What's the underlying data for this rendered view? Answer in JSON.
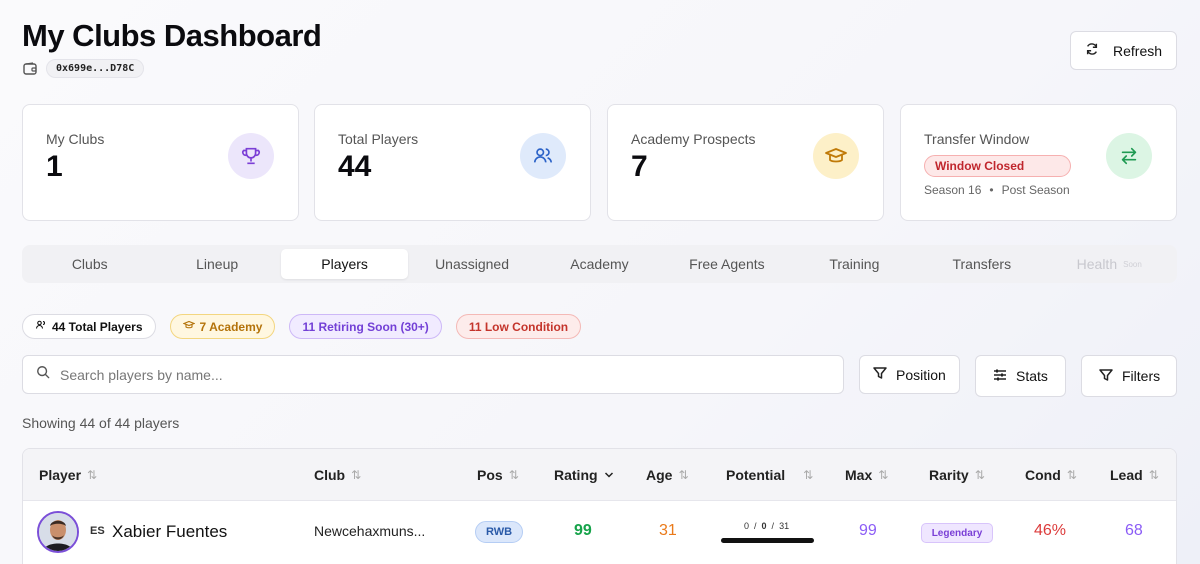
{
  "header": {
    "title": "My Clubs Dashboard",
    "wallet_address": "0x699e...D78C",
    "refresh_label": "Refresh"
  },
  "stats": {
    "clubs": {
      "label": "My Clubs",
      "value": "1",
      "icon": "trophy-icon"
    },
    "players": {
      "label": "Total Players",
      "value": "44",
      "icon": "users-icon"
    },
    "academy": {
      "label": "Academy Prospects",
      "value": "7",
      "icon": "graduation-cap-icon"
    },
    "transfer": {
      "label": "Transfer Window",
      "status": "Window Closed",
      "season": "Season 16",
      "phase": "Post Season",
      "icon": "swap-arrows-icon"
    }
  },
  "tabs": [
    {
      "label": "Clubs"
    },
    {
      "label": "Lineup"
    },
    {
      "label": "Players"
    },
    {
      "label": "Unassigned"
    },
    {
      "label": "Academy"
    },
    {
      "label": "Free Agents"
    },
    {
      "label": "Training"
    },
    {
      "label": "Transfers"
    },
    {
      "label": "Health",
      "badge": "Soon"
    }
  ],
  "active_tab": "Players",
  "chips": {
    "total": "44 Total Players",
    "academy": "7 Academy",
    "retiring": "11 Retiring Soon (30+)",
    "low": "11 Low Condition"
  },
  "search": {
    "placeholder": "Search players by name..."
  },
  "filters": {
    "position": "Position",
    "stats": "Stats",
    "filters": "Filters"
  },
  "showing": "Showing 44 of 44 players",
  "table": {
    "columns": [
      "Player",
      "Club",
      "Pos",
      "Rating",
      "Age",
      "Potential",
      "Max",
      "Rarity",
      "Cond",
      "Lead"
    ],
    "rows": [
      {
        "nationality": "ES",
        "name": "Xabier Fuentes",
        "club": "Newcehaxmuns...",
        "pos": "RWB",
        "rating": "99",
        "age": "31",
        "potential_a": "0",
        "potential_b": "0",
        "potential_c": "31",
        "max": "99",
        "rarity": "Legendary",
        "cond": "46%",
        "lead": "68"
      }
    ]
  },
  "colors": {
    "rating": "#16a34a",
    "age": "#ea7a1a",
    "max": "#8b5cf6",
    "cond": "#dc3b3b",
    "lead": "#8b5cf6"
  }
}
